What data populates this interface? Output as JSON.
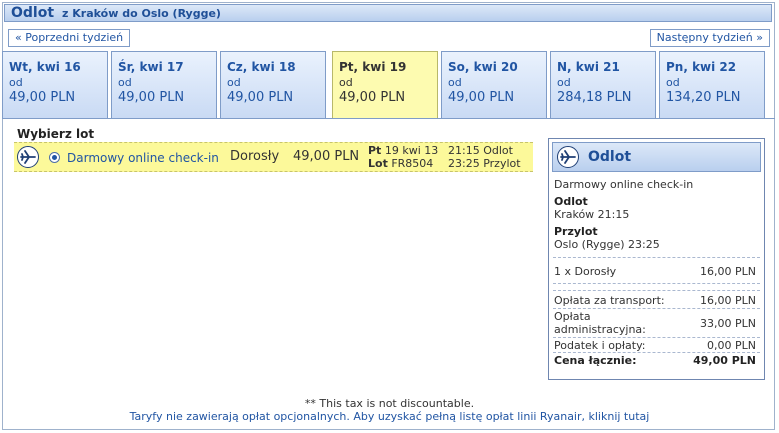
{
  "header": {
    "title": "Odlot",
    "route": "z Kraków do Oslo (Rygge)"
  },
  "nav": {
    "prev_label": "« Poprzedni tydzień",
    "next_label": "Następny tydzień »"
  },
  "days": [
    {
      "label": "Wt, kwi 16",
      "od": "od",
      "price": "49,00 PLN",
      "selected": false
    },
    {
      "label": "Śr, kwi 17",
      "od": "od",
      "price": "49,00 PLN",
      "selected": false
    },
    {
      "label": "Cz, kwi 18",
      "od": "od",
      "price": "49,00 PLN",
      "selected": false
    },
    {
      "label": "Pt, kwi 19",
      "od": "od",
      "price": "49,00 PLN",
      "selected": true
    },
    {
      "label": "So, kwi 20",
      "od": "od",
      "price": "49,00 PLN",
      "selected": false
    },
    {
      "label": "N, kwi 21",
      "od": "od",
      "price": "284,18 PLN",
      "selected": false
    },
    {
      "label": "Pn, kwi 22",
      "od": "od",
      "price": "134,20 PLN",
      "selected": false
    }
  ],
  "flight": {
    "choose_label": "Wybierz lot",
    "checkin": "Darmowy online check-in",
    "passenger": "Dorosły",
    "price": "49,00 PLN",
    "day_abbr": "Pt",
    "date": "19 kwi 13",
    "flight_label": "Lot",
    "flight_no": "FR8504",
    "dep_time": "21:15",
    "dep_label": "Odlot",
    "arr_time": "23:25",
    "arr_label": "Przylot"
  },
  "summary": {
    "title": "Odlot",
    "checkin": "Darmowy online check-in",
    "dep_heading": "Odlot",
    "dep_value": "Kraków 21:15",
    "arr_heading": "Przylot",
    "arr_value": "Oslo (Rygge) 23:25",
    "pax_label": "1 x Dorosły",
    "pax_price": "16,00 PLN",
    "transport_label": "Opłata za transport:",
    "transport_price": "16,00 PLN",
    "admin_label_1": "Opłata",
    "admin_label_2": "administracyjna:",
    "admin_price": "33,00 PLN",
    "tax_label": "Podatek i opłaty:",
    "tax_price": "0,00 PLN",
    "total_label": "Cena łącznie:",
    "total_price": "49,00 PLN"
  },
  "footer": {
    "note": "** This tax is not discountable.",
    "link": "Taryfy nie zawierają opłat opcjonalnych. Aby uzyskać pełną listę opłat linii Ryanair, kliknij tutaj"
  }
}
